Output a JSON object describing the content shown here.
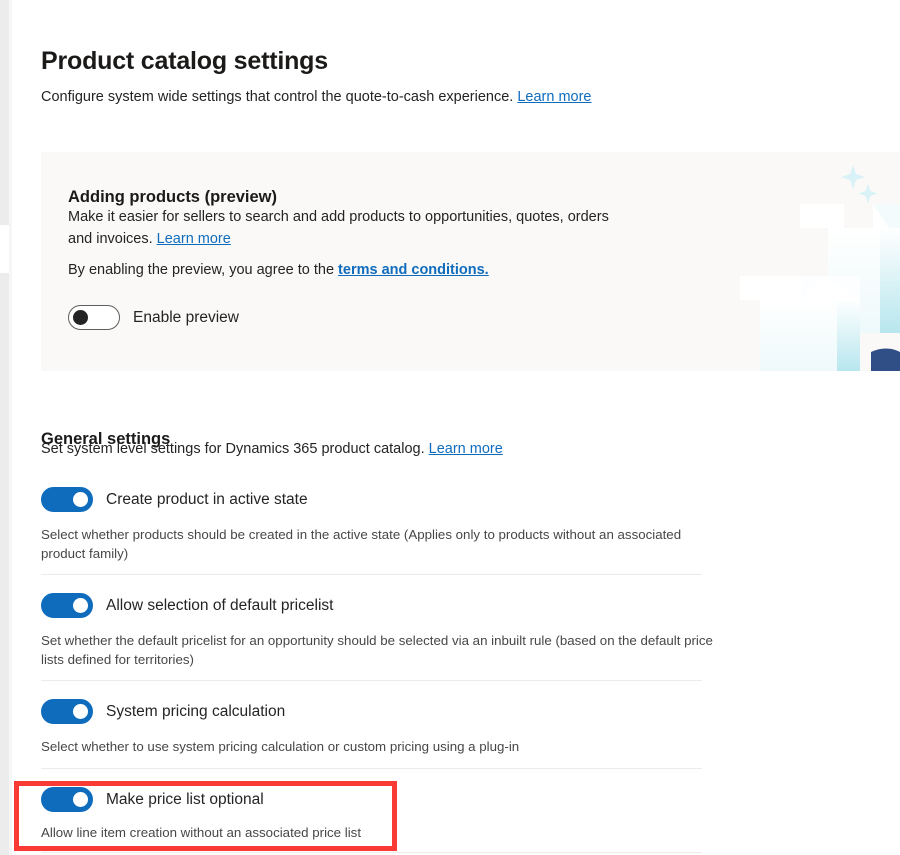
{
  "page": {
    "title": "Product catalog settings",
    "subtitle_text": "Configure system wide settings that control the quote-to-cash experience.",
    "subtitle_link": "Learn more"
  },
  "preview_card": {
    "title": "Adding products (preview)",
    "description": "Make it easier for sellers to search and add products to opportunities, quotes, orders and invoices.",
    "description_link": "Learn more",
    "terms_text": "By enabling the preview, you agree to the",
    "terms_link": "terms and conditions.",
    "toggle": {
      "label": "Enable preview",
      "state": "off"
    },
    "art": {
      "name": "open-boxes-illustration",
      "sparkle_color": "#d9f2f7",
      "box_accent_color": "#b9e8ef",
      "box_base_color": "#2f4f86"
    }
  },
  "general_settings": {
    "title": "General settings",
    "description_text": "Set system level settings for Dynamics 365 product catalog.",
    "description_link": "Learn more",
    "items": [
      {
        "label": "Create product in active state",
        "state": "on",
        "description": "Select whether products should be created in the active state (Applies only to products without an associated product family)"
      },
      {
        "label": "Allow selection of default pricelist",
        "state": "on",
        "description": "Set whether the default pricelist for an opportunity should be selected via an inbuilt rule (based on the default price lists defined for territories)"
      },
      {
        "label": "System pricing calculation",
        "state": "on",
        "description": "Select whether to use system pricing calculation or custom pricing using a plug-in"
      },
      {
        "label": "Make price list optional",
        "state": "on",
        "description": "Allow line item creation without an associated price list"
      }
    ]
  },
  "colors": {
    "accent": "#0f6cbd",
    "link": "#0f6cbd",
    "highlight": "#f93a35",
    "card_background": "#faf9f8",
    "divider": "#edebe9"
  }
}
